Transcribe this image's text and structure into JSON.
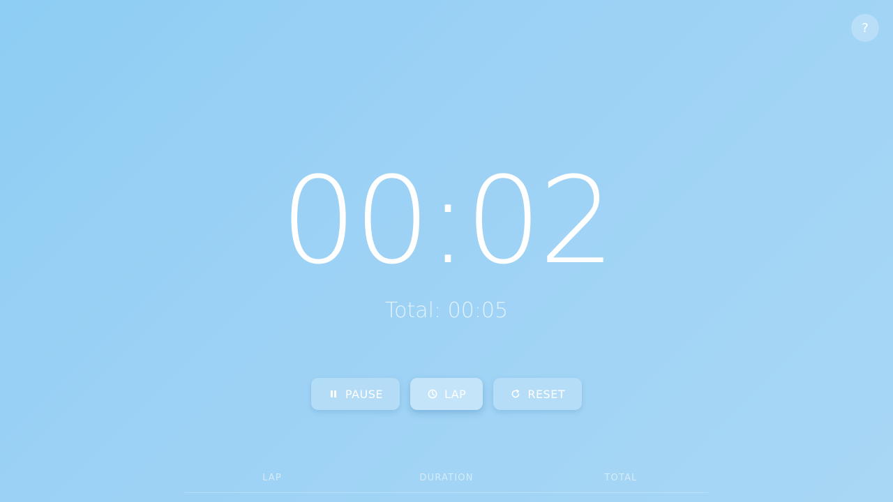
{
  "help": {
    "label": "?",
    "icon": "help-icon"
  },
  "timer": {
    "display": "00:02"
  },
  "total": {
    "text": "Total: 00:05"
  },
  "controls": {
    "pause": {
      "label": "PAUSE",
      "icon": "pause-icon"
    },
    "lap": {
      "label": "LAP",
      "icon": "clock-icon"
    },
    "reset": {
      "label": "RESET",
      "icon": "refresh-icon"
    }
  },
  "laps_table": {
    "columns": [
      "LAP",
      "DURATION",
      "TOTAL"
    ],
    "rows": []
  },
  "colors": {
    "background_start": "#8ecdf4",
    "background_end": "#a8d7f5",
    "text": "#ffffff"
  }
}
